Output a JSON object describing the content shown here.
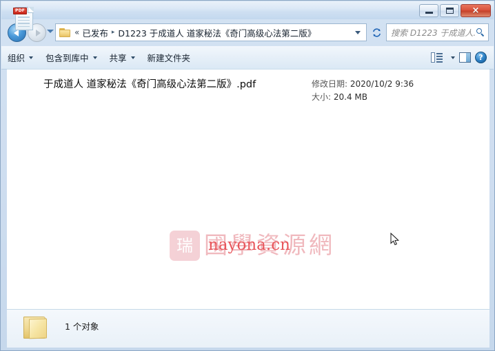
{
  "window": {
    "minimize_label": "最小化",
    "maximize_label": "最大化",
    "close_label": "×"
  },
  "nav": {
    "back_label": "后退",
    "forward_label": "前进",
    "history_label": "最近浏览的位置",
    "refresh_label": "刷新",
    "breadcrumb": {
      "overflow": "«",
      "parent": "已发布",
      "separator": "▸",
      "current": "D1223 于成道人 道家秘法《奇门高级心法第二版》"
    }
  },
  "search": {
    "placeholder": "搜索 D1223 于成道人...",
    "icon": "search-icon"
  },
  "toolbar": {
    "items": [
      {
        "label": "组织",
        "has_caret": true
      },
      {
        "label": "包含到库中",
        "has_caret": true
      },
      {
        "label": "共享",
        "has_caret": true
      },
      {
        "label": "新建文件夹",
        "has_caret": false
      }
    ],
    "view_icon": "view-options-icon",
    "view_caret": "chevron-down-icon",
    "preview_icon": "preview-pane-icon",
    "help_icon": "help-icon",
    "help_glyph": "?"
  },
  "file": {
    "icon": "pdf-file-icon",
    "badge": "PDF",
    "name": "于成道人 道家秘法《奇门高级心法第二版》.pdf",
    "modified_label": "修改日期:",
    "modified_value": "2020/10/2 9:36",
    "size_label": "大小:",
    "size_value": "20.4 MB"
  },
  "watermark": {
    "stamp_glyph": "瑞",
    "chinese": "國學資源網",
    "site": "nayona.cn",
    "color_pink": "#f0b9be",
    "color_red": "#e8565b"
  },
  "status": {
    "folder_icon": "folder-icon",
    "text": "1 个对象"
  },
  "colors": {
    "titlebar": "#cfe0f2",
    "toolbar": "#e6eff8",
    "content_bg": "#ffffff",
    "border": "#8ba6c4",
    "close_button": "#c33f28"
  }
}
